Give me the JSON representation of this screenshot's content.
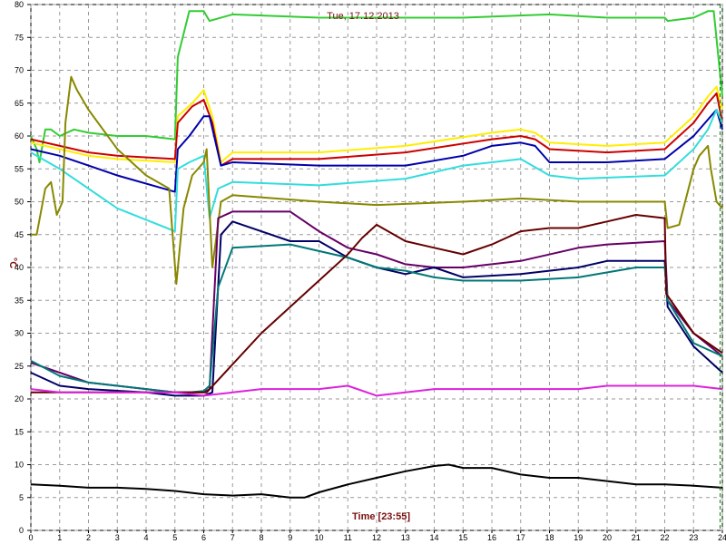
{
  "chart_data": {
    "type": "line",
    "title": "Tue, 17.12.2013",
    "xlabel": "Time [23:55]",
    "ylabel": "°C",
    "xlim": [
      0,
      24
    ],
    "ylim": [
      0,
      80
    ],
    "x_ticks": [
      "0",
      "1",
      "2",
      "3",
      "4",
      "5",
      "6",
      "7",
      "8",
      "9",
      "10",
      "11",
      "12",
      "13",
      "14",
      "15",
      "16",
      "17",
      "18",
      "19",
      "20",
      "21",
      "22",
      "23",
      "24"
    ],
    "y_ticks": [
      "0",
      "5",
      "10",
      "15",
      "20",
      "25",
      "30",
      "35",
      "40",
      "45",
      "50",
      "55",
      "60",
      "65",
      "70",
      "75",
      "80"
    ],
    "grid": true,
    "current_time_marker": 23.92,
    "series": [
      {
        "color": "#33cc33",
        "x": [
          0,
          0.2,
          0.3,
          0.5,
          0.7,
          1,
          1.5,
          2,
          3,
          4,
          5,
          5.1,
          5.5,
          6,
          6.2,
          7,
          10,
          15,
          18,
          20,
          22,
          22.1,
          23,
          23.5,
          23.7,
          24
        ],
        "y": [
          60,
          58,
          56,
          61,
          61,
          60,
          61,
          60.5,
          60,
          60,
          59.5,
          72,
          79,
          79,
          77.5,
          78.5,
          78,
          78,
          78.5,
          78,
          78,
          77.5,
          78,
          79,
          79,
          66
        ]
      },
      {
        "color": "#ffee00",
        "x": [
          0,
          1,
          2,
          3,
          5,
          5.1,
          5.6,
          6,
          6.3,
          6.6,
          7,
          10,
          13,
          16,
          17,
          17.5,
          18,
          20,
          22,
          23,
          23.5,
          23.8,
          24
        ],
        "y": [
          59,
          58,
          57,
          56.5,
          56,
          63,
          65,
          67,
          63,
          56,
          57.5,
          57.5,
          58.5,
          60.5,
          61,
          60.5,
          59,
          58.5,
          59,
          63,
          66,
          67.5,
          64
        ]
      },
      {
        "color": "#cc0000",
        "x": [
          0,
          1,
          2,
          3,
          5,
          5.1,
          5.6,
          6,
          6.3,
          6.6,
          7,
          10,
          13,
          16,
          17,
          17.5,
          18,
          20,
          22,
          23,
          23.5,
          23.8,
          24
        ],
        "y": [
          59.5,
          58.5,
          57.5,
          57,
          56.5,
          62,
          64.5,
          65.5,
          62,
          55.5,
          56.5,
          56.5,
          57.5,
          59.5,
          60,
          59.5,
          58,
          57.5,
          58,
          62,
          65,
          66.5,
          62
        ]
      },
      {
        "color": "#0000aa",
        "x": [
          0,
          1,
          2,
          3,
          5,
          5.1,
          5.5,
          6,
          6.2,
          6.6,
          7,
          10,
          13,
          15,
          16,
          17,
          17.5,
          18,
          20,
          22,
          23,
          23.5,
          23.8,
          24
        ],
        "y": [
          58,
          57,
          55.5,
          54,
          51.5,
          58,
          60,
          63,
          63,
          55.5,
          56,
          55.5,
          55.5,
          57,
          58.5,
          59,
          58.5,
          56,
          56,
          56.5,
          60,
          62.5,
          64,
          61
        ]
      },
      {
        "color": "#33dddd",
        "x": [
          0,
          1,
          2,
          3,
          5,
          5.1,
          5.5,
          6,
          6.2,
          6.5,
          7,
          10,
          13,
          15,
          16,
          17,
          18,
          19,
          22,
          23,
          23.5,
          23.8,
          24
        ],
        "y": [
          57.5,
          55,
          52,
          49,
          45.5,
          55,
          56,
          57,
          47.5,
          52,
          53,
          52.5,
          53.5,
          55.5,
          56,
          56.5,
          54,
          53.5,
          54,
          58,
          61,
          64,
          62
        ]
      },
      {
        "color": "#888800",
        "x": [
          0,
          0.2,
          0.5,
          0.7,
          0.9,
          1.1,
          1.2,
          1.4,
          1.6,
          2,
          3,
          4,
          4.8,
          5.05,
          5.3,
          5.6,
          6,
          6.1,
          6.3,
          6.6,
          7,
          10,
          12,
          15,
          17,
          19,
          22,
          22.1,
          22.5,
          23,
          23.2,
          23.5,
          23.6,
          23.8,
          24
        ],
        "y": [
          45,
          45,
          52,
          53,
          48,
          50,
          62,
          69,
          67,
          64,
          58,
          54,
          52,
          37.5,
          49,
          54,
          56,
          58,
          40,
          50,
          51,
          50,
          49.5,
          50,
          50.5,
          50,
          50,
          46,
          46.5,
          55,
          57,
          58.5,
          55,
          50,
          49
        ]
      },
      {
        "color": "#660066",
        "x": [
          0,
          1,
          2,
          4,
          5,
          6,
          6.2,
          6.5,
          7,
          9,
          10,
          11,
          12,
          13,
          14,
          15,
          17,
          19,
          20,
          22,
          22.1,
          23,
          24
        ],
        "y": [
          25.5,
          24,
          22.5,
          21.5,
          21,
          21,
          21.5,
          47.5,
          48.5,
          48.5,
          45.5,
          43,
          42,
          40.5,
          40,
          40,
          41,
          43,
          43.5,
          44,
          35,
          30,
          26.5
        ]
      },
      {
        "color": "#000066",
        "x": [
          0,
          1,
          2,
          4,
          5,
          6,
          6.3,
          6.6,
          7,
          9,
          10,
          11,
          12,
          13,
          14,
          15,
          17,
          19,
          20,
          22,
          22.1,
          23,
          24
        ],
        "y": [
          24,
          22,
          21.5,
          21,
          20.5,
          20.5,
          21,
          45,
          47,
          44,
          44,
          41.5,
          40,
          39,
          40,
          38.5,
          39,
          40,
          41,
          41,
          34,
          28,
          24
        ]
      },
      {
        "color": "#007777",
        "x": [
          0,
          1,
          2,
          4,
          5,
          5.5,
          6,
          6.2,
          6.5,
          7,
          9,
          10,
          11,
          12,
          13,
          14,
          15,
          17,
          19,
          21,
          22,
          22.1,
          23,
          24
        ],
        "y": [
          25.8,
          23.5,
          22.5,
          21.5,
          21,
          21,
          21.2,
          22,
          37,
          43,
          43.5,
          42.5,
          41.5,
          40,
          39.5,
          38.5,
          38,
          38,
          38.5,
          40,
          40,
          35,
          28.5,
          26.5
        ]
      },
      {
        "color": "#660000",
        "x": [
          0,
          2,
          4,
          6,
          6.1,
          8,
          10,
          11,
          11.5,
          12,
          13,
          14,
          15,
          16,
          17,
          18,
          19,
          20,
          21,
          22,
          22.05,
          23,
          24
        ],
        "y": [
          21,
          21,
          21,
          21,
          21,
          30,
          38,
          42,
          44.5,
          46.5,
          44,
          43,
          42,
          43.5,
          45.5,
          46,
          46,
          47,
          48,
          47.5,
          36,
          30,
          27
        ]
      },
      {
        "color": "#dd22dd",
        "x": [
          0,
          1,
          2,
          3,
          4,
          5,
          6,
          7,
          8,
          9,
          10,
          11,
          12,
          13,
          14,
          15,
          16,
          17,
          18,
          19,
          20,
          21,
          22,
          23,
          24
        ],
        "y": [
          21.5,
          21,
          21,
          21,
          21,
          21,
          20.5,
          21,
          21.5,
          21.5,
          21.5,
          22,
          20.5,
          21,
          21.5,
          21.5,
          21.5,
          21.5,
          21.5,
          21.5,
          22,
          22,
          22,
          22,
          21.5
        ]
      },
      {
        "color": "#000000",
        "x": [
          0,
          1,
          2,
          3,
          4,
          5,
          6,
          7,
          8,
          9,
          9.5,
          10,
          11,
          12,
          13,
          14,
          14.5,
          15,
          16,
          17,
          18,
          19,
          20,
          21,
          22,
          23,
          24
        ],
        "y": [
          7,
          6.8,
          6.5,
          6.5,
          6.3,
          6,
          5.5,
          5.3,
          5.5,
          5,
          5,
          5.8,
          7,
          8,
          9,
          9.8,
          10,
          9.5,
          9.5,
          8.5,
          8,
          8,
          7.5,
          7,
          7,
          6.8,
          6.5
        ]
      }
    ]
  }
}
